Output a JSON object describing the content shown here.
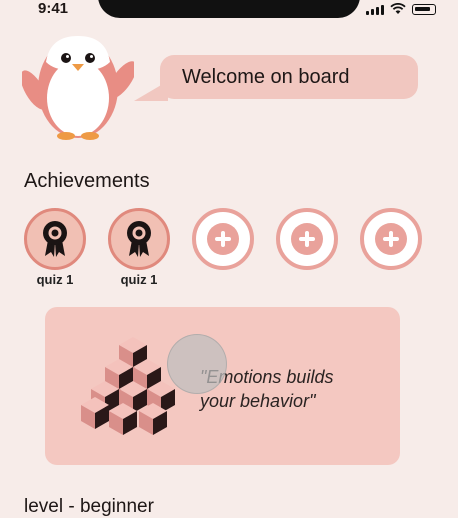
{
  "status_bar": {
    "time": "9:41"
  },
  "welcome": {
    "message": "Welcome on board"
  },
  "achievements": {
    "title": "Achievements",
    "badges": [
      {
        "state": "earned",
        "caption": "quiz 1",
        "icon": "medal-icon"
      },
      {
        "state": "earned",
        "caption": "quiz 1",
        "icon": "medal-icon"
      },
      {
        "state": "locked",
        "icon": "plus-icon"
      },
      {
        "state": "locked",
        "icon": "plus-icon"
      },
      {
        "state": "locked",
        "icon": "plus-icon"
      }
    ]
  },
  "quote_card": {
    "line1": "\"Emotions builds",
    "line2": "your behavior\"",
    "icon": "cubes-icon"
  },
  "level": {
    "text": "level - beginner"
  },
  "colors": {
    "background": "#f7ece9",
    "accent": "#e9a29b",
    "bubble": "#f1c7c0",
    "card": "#f4c8c1"
  }
}
